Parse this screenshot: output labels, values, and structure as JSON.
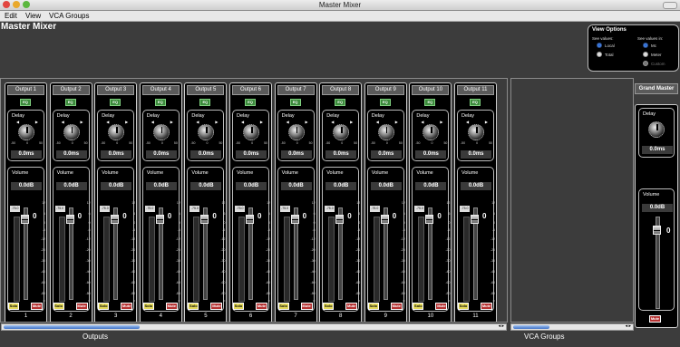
{
  "window": {
    "title": "Master Mixer"
  },
  "menu": {
    "items": [
      "Edit",
      "View",
      "VCA Groups"
    ]
  },
  "app_title": "Master Mixer",
  "view_options": {
    "title": "View Options",
    "see_values_label": "See values:",
    "see_values_in_label": "See values in:",
    "radio_local": "Local",
    "radio_total": "Total",
    "radio_mc": "Mc",
    "radio_meter": "Meter",
    "radio_custom": "Custom"
  },
  "strip_common": {
    "eq": "EQ",
    "delay_label": "Delay",
    "delay_value": "0.0ms",
    "delay_min": "-50",
    "delay_mid": "0",
    "delay_max": "50",
    "volume_label": "Volume",
    "volume_value": "0.0dB",
    "peak": "-75.0",
    "fader_big": "0",
    "scale": [
      "12",
      "6",
      "0",
      "-6",
      "-12",
      "-20",
      "-30",
      "-40",
      "-60",
      "-80",
      "∞"
    ],
    "solo": "Solo",
    "mute": "Mute"
  },
  "outputs": [
    {
      "name": "Output 1",
      "num": "1"
    },
    {
      "name": "Output 2",
      "num": "2"
    },
    {
      "name": "Output 3",
      "num": "3"
    },
    {
      "name": "Output 4",
      "num": "4"
    },
    {
      "name": "Output 5",
      "num": "5"
    },
    {
      "name": "Output 6",
      "num": "6"
    },
    {
      "name": "Output 7",
      "num": "7"
    },
    {
      "name": "Output 8",
      "num": "8"
    },
    {
      "name": "Output 9",
      "num": "9"
    },
    {
      "name": "Output 10",
      "num": "10"
    },
    {
      "name": "Output 11",
      "num": "11"
    }
  ],
  "outputs_label": "Outputs",
  "vca_label": "VCA Groups",
  "grand_master": {
    "title": "Grand Master",
    "delay_label": "Delay",
    "delay_value": "0.0ms",
    "volume_label": "Volume",
    "volume_value": "0.0dB",
    "fader_big": "0",
    "mute": "Mute"
  },
  "colors": {
    "background": "#3c3c3c",
    "strip": "#000000",
    "solo": "#e3d85a",
    "mute": "#b53232",
    "eq": "#3b8a3b"
  }
}
